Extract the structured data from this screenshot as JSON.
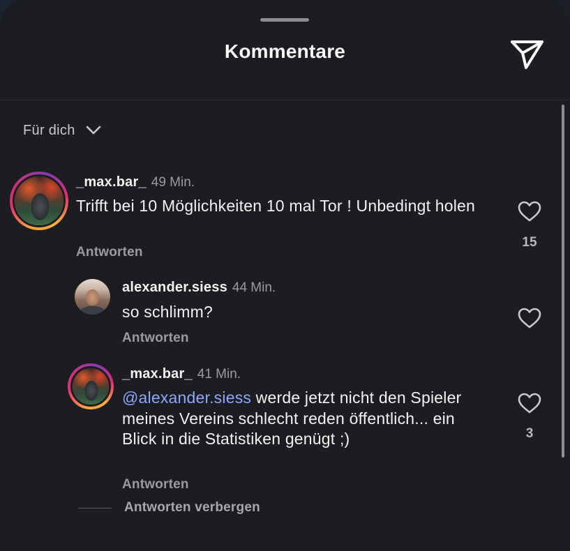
{
  "header": {
    "title": "Kommentare",
    "share_icon": "paper-plane-icon"
  },
  "filter": {
    "label": "Für dich",
    "icon": "chevron-down-icon"
  },
  "comments": [
    {
      "username": "_max.bar_",
      "time": "49 Min.",
      "text": "Trifft bei 10 Möglichkeiten 10 mal Tor ! Unbedingt holen",
      "reply_label": "Antworten",
      "likes": "15",
      "avatar": "stadium-photo",
      "has_story_ring": true
    },
    {
      "username": "alexander.siess",
      "time": "44 Min.",
      "text": "so schlimm?",
      "reply_label": "Antworten",
      "likes": "",
      "avatar": "selfie-photo",
      "has_story_ring": false
    },
    {
      "username": "_max.bar_",
      "time": "41 Min.",
      "mention": "@alexander.siess",
      "text": " werde jetzt nicht den Spieler meines Vereins schlecht reden öffentlich... ein Blick in die Statistiken genügt ;)",
      "reply_label": "Antworten",
      "likes": "3",
      "avatar": "stadium-photo",
      "has_story_ring": true
    }
  ],
  "hide_replies_label": "Antworten verbergen",
  "colors": {
    "sheet_bg": "#1c1d21",
    "mention": "#8ea7ff",
    "muted": "#9a9ba0"
  }
}
